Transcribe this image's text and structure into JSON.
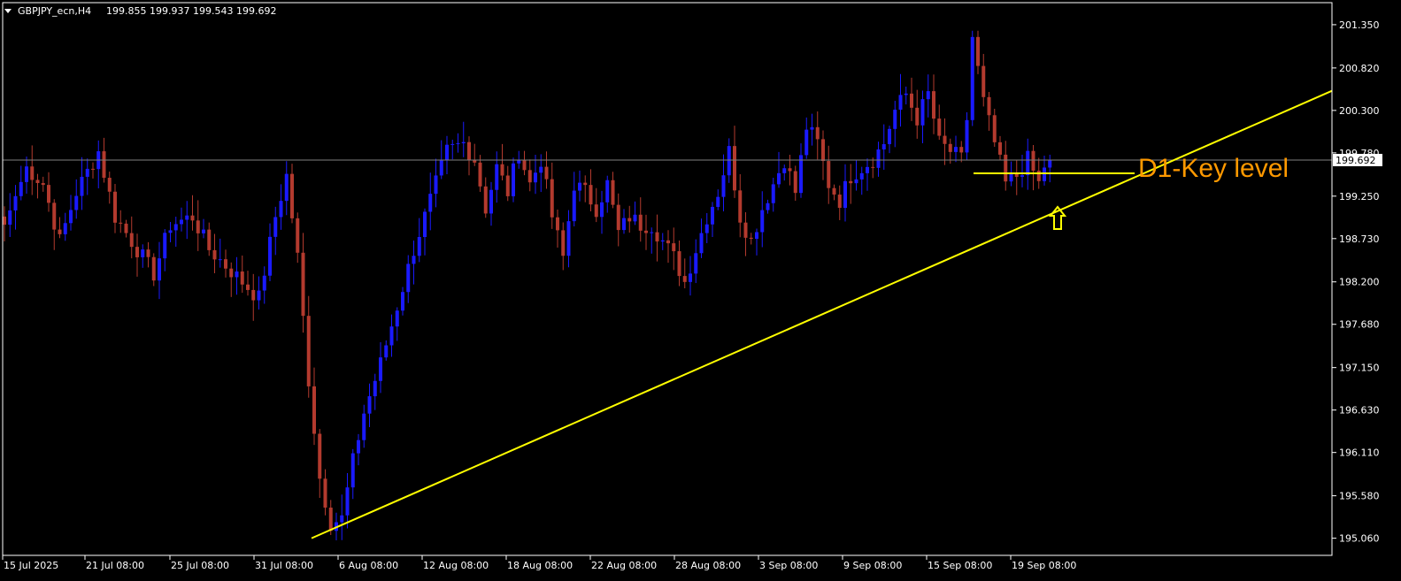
{
  "header": {
    "symbol": "GBPJPY_ecn,H4",
    "ohlc": "199.855 199.937 199.543 199.692"
  },
  "colors": {
    "background": "#000000",
    "bull": "#1a1aff",
    "bear": "#b33a2e",
    "trendline": "#ffff00",
    "key_level": "#ffff00",
    "annotation": "#ff9900",
    "axis": "#ffffff",
    "price_line": "#7f7f7f"
  },
  "chart_data": {
    "type": "candlestick",
    "ylim": [
      194.85,
      201.62
    ],
    "y_ticks": [
      "201.350",
      "200.820",
      "200.300",
      "199.780",
      "199.250",
      "198.730",
      "198.200",
      "197.680",
      "197.150",
      "196.630",
      "196.110",
      "195.580",
      "195.060"
    ],
    "x_ticks": [
      "15 Jul 2025",
      "21 Jul 08:00",
      "25 Jul 08:00",
      "31 Jul 08:00",
      "6 Aug 08:00",
      "12 Aug 08:00",
      "18 Aug 08:00",
      "22 Aug 08:00",
      "28 Aug 08:00",
      "3 Sep 08:00",
      "9 Sep 08:00",
      "15 Sep 08:00",
      "19 Sep 08:00"
    ],
    "current_price": "199.692",
    "key_level": {
      "label": "D1-Key level",
      "price": 199.53
    },
    "trendline": {
      "from_price": 195.06,
      "to_price": 200.54
    },
    "arrow": "up",
    "grid": false,
    "anchors": [
      [
        0,
        198.9
      ],
      [
        4,
        199.6
      ],
      [
        7,
        199.4
      ],
      [
        10,
        198.7
      ],
      [
        13,
        199.3
      ],
      [
        17,
        199.8
      ],
      [
        20,
        199.0
      ],
      [
        24,
        198.6
      ],
      [
        27,
        198.3
      ],
      [
        30,
        198.9
      ],
      [
        34,
        199.0
      ],
      [
        37,
        198.6
      ],
      [
        40,
        198.4
      ],
      [
        43,
        198.2
      ],
      [
        46,
        198.0
      ],
      [
        49,
        199.0
      ],
      [
        51,
        199.5
      ],
      [
        53,
        198.5
      ],
      [
        55,
        197.0
      ],
      [
        57,
        195.8
      ],
      [
        59,
        195.25
      ],
      [
        61,
        195.3
      ],
      [
        63,
        196.0
      ],
      [
        65,
        196.6
      ],
      [
        68,
        197.2
      ],
      [
        71,
        197.9
      ],
      [
        74,
        198.6
      ],
      [
        77,
        199.2
      ],
      [
        80,
        199.8
      ],
      [
        83,
        199.9
      ],
      [
        85,
        199.7
      ],
      [
        87,
        199.1
      ],
      [
        89,
        199.6
      ],
      [
        91,
        199.3
      ],
      [
        93,
        199.8
      ],
      [
        95,
        199.4
      ],
      [
        97,
        199.7
      ],
      [
        99,
        199.0
      ],
      [
        101,
        198.5
      ],
      [
        103,
        199.4
      ],
      [
        105,
        199.3
      ],
      [
        107,
        199.1
      ],
      [
        109,
        199.4
      ],
      [
        111,
        198.8
      ],
      [
        113,
        199.0
      ],
      [
        115,
        198.9
      ],
      [
        117,
        198.9
      ],
      [
        119,
        198.7
      ],
      [
        121,
        198.5
      ],
      [
        123,
        198.2
      ],
      [
        125,
        198.6
      ],
      [
        127,
        199.0
      ],
      [
        129,
        199.3
      ],
      [
        131,
        199.8
      ],
      [
        133,
        199.0
      ],
      [
        135,
        198.7
      ],
      [
        137,
        199.1
      ],
      [
        139,
        199.4
      ],
      [
        141,
        199.7
      ],
      [
        143,
        199.3
      ],
      [
        145,
        200.1
      ],
      [
        147,
        199.9
      ],
      [
        149,
        199.4
      ],
      [
        151,
        199.2
      ],
      [
        153,
        199.5
      ],
      [
        155,
        199.6
      ],
      [
        157,
        199.7
      ],
      [
        159,
        199.9
      ],
      [
        161,
        200.3
      ],
      [
        163,
        200.5
      ],
      [
        165,
        200.2
      ],
      [
        167,
        200.5
      ],
      [
        169,
        199.9
      ],
      [
        171,
        199.8
      ],
      [
        173,
        199.7
      ],
      [
        174,
        200.2
      ],
      [
        175,
        201.2
      ],
      [
        177,
        200.4
      ],
      [
        179,
        199.9
      ],
      [
        181,
        199.4
      ],
      [
        183,
        199.5
      ],
      [
        185,
        199.7
      ],
      [
        187,
        199.4
      ],
      [
        188,
        199.6
      ],
      [
        189,
        199.69
      ]
    ]
  }
}
